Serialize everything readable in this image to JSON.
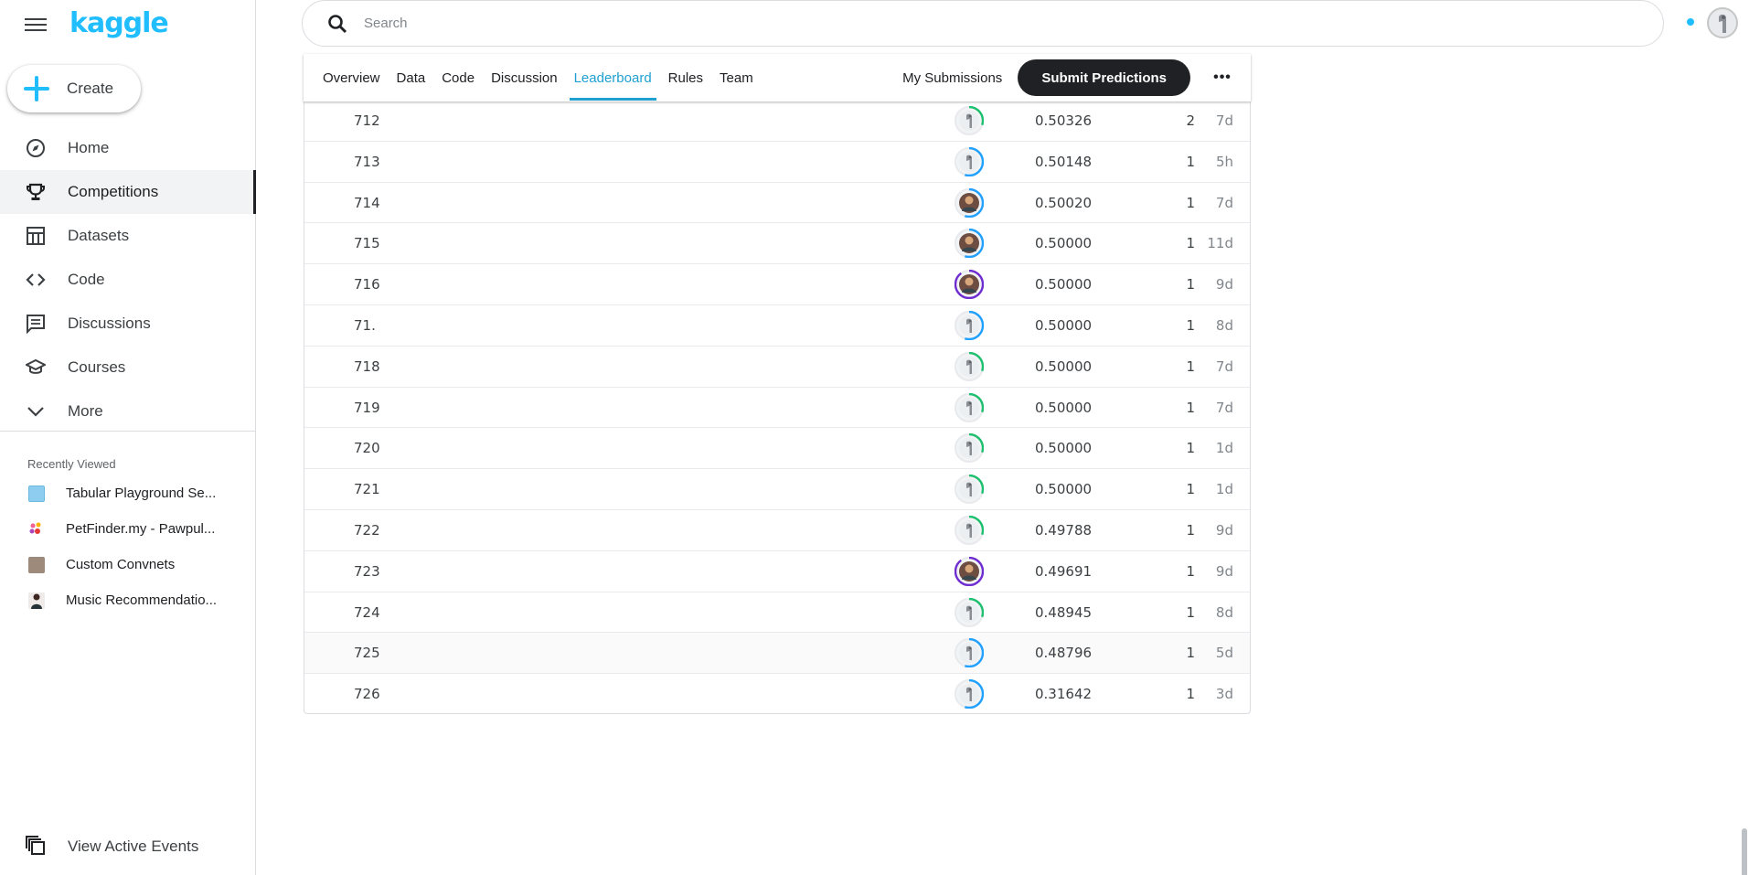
{
  "app": {
    "logo": "kaggle",
    "create_label": "Create"
  },
  "nav": [
    {
      "label": "Home",
      "icon": "compass-icon",
      "active": false
    },
    {
      "label": "Competitions",
      "icon": "trophy-icon",
      "active": true
    },
    {
      "label": "Datasets",
      "icon": "table-icon",
      "active": false
    },
    {
      "label": "Code",
      "icon": "code-icon",
      "active": false
    },
    {
      "label": "Discussions",
      "icon": "discussion-icon",
      "active": false
    },
    {
      "label": "Courses",
      "icon": "school-icon",
      "active": false
    },
    {
      "label": "More",
      "icon": "chevron-down-icon",
      "active": false
    }
  ],
  "recent": {
    "title": "Recently Viewed",
    "items": [
      {
        "label": "Tabular Playground Se...",
        "color": "#8ecdf0"
      },
      {
        "label": "PetFinder.my - Pawpul...",
        "color": "#f06292"
      },
      {
        "label": "Custom Convnets",
        "color": "#9e8a7a"
      },
      {
        "label": "Music Recommendatio...",
        "color": "#5d4037"
      }
    ]
  },
  "view_events_label": "View Active Events",
  "search": {
    "placeholder": "Search"
  },
  "tabs": [
    {
      "label": "Overview",
      "active": false
    },
    {
      "label": "Data",
      "active": false
    },
    {
      "label": "Code",
      "active": false
    },
    {
      "label": "Discussion",
      "active": false
    },
    {
      "label": "Leaderboard",
      "active": true
    },
    {
      "label": "Rules",
      "active": false
    },
    {
      "label": "Team",
      "active": false
    }
  ],
  "toolbar": {
    "my_submissions": "My Submissions",
    "submit": "Submit Predictions",
    "more": "•••"
  },
  "colors": {
    "accent": "#20beff",
    "ring_green": "#1ebf6f",
    "ring_blue": "#20a0ff",
    "ring_purple": "#6f2dd0",
    "dark_button": "#202124"
  },
  "rows": [
    {
      "rank": "712",
      "score": "0.50326",
      "entries": "2",
      "last": "7d",
      "ring": "green",
      "avatar": "default"
    },
    {
      "rank": "713",
      "score": "0.50148",
      "entries": "1",
      "last": "5h",
      "ring": "blue",
      "avatar": "default"
    },
    {
      "rank": "714",
      "score": "0.50020",
      "entries": "1",
      "last": "7d",
      "ring": "blue",
      "avatar": "photo"
    },
    {
      "rank": "715",
      "score": "0.50000",
      "entries": "1",
      "last": "11d",
      "ring": "blue",
      "avatar": "photo"
    },
    {
      "rank": "716",
      "score": "0.50000",
      "entries": "1",
      "last": "9d",
      "ring": "purple",
      "avatar": "photo"
    },
    {
      "rank": "71.",
      "score": "0.50000",
      "entries": "1",
      "last": "8d",
      "ring": "blue",
      "avatar": "default"
    },
    {
      "rank": "718",
      "score": "0.50000",
      "entries": "1",
      "last": "7d",
      "ring": "green",
      "avatar": "default"
    },
    {
      "rank": "719",
      "score": "0.50000",
      "entries": "1",
      "last": "7d",
      "ring": "green",
      "avatar": "default"
    },
    {
      "rank": "720",
      "score": "0.50000",
      "entries": "1",
      "last": "1d",
      "ring": "green",
      "avatar": "default"
    },
    {
      "rank": "721",
      "score": "0.50000",
      "entries": "1",
      "last": "1d",
      "ring": "green",
      "avatar": "default"
    },
    {
      "rank": "722",
      "score": "0.49788",
      "entries": "1",
      "last": "9d",
      "ring": "green",
      "avatar": "default"
    },
    {
      "rank": "723",
      "score": "0.49691",
      "entries": "1",
      "last": "9d",
      "ring": "purple",
      "avatar": "photo"
    },
    {
      "rank": "724",
      "score": "0.48945",
      "entries": "1",
      "last": "8d",
      "ring": "green",
      "avatar": "default"
    },
    {
      "rank": "725",
      "score": "0.48796",
      "entries": "1",
      "last": "5d",
      "ring": "blue",
      "avatar": "default"
    },
    {
      "rank": "726",
      "score": "0.31642",
      "entries": "1",
      "last": "3d",
      "ring": "blue",
      "avatar": "default"
    }
  ]
}
